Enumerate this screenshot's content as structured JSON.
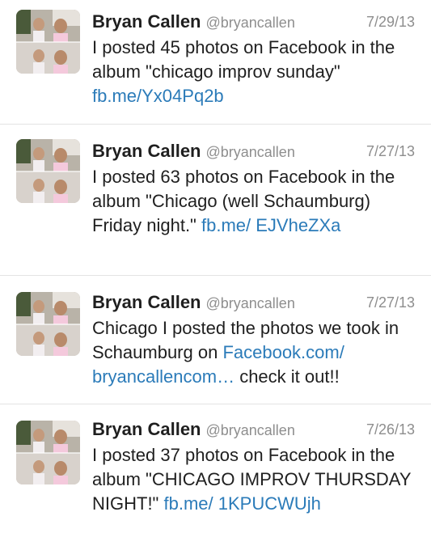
{
  "tweets": [
    {
      "name": "Bryan Callen",
      "handle": "@bryancallen",
      "date": "7/29/13",
      "text": "I posted 45 photos on Facebook in the album \"chicago improv sunday\" ",
      "link": "fb.me/Yx04Pq2b",
      "text_after": ""
    },
    {
      "name": "Bryan Callen",
      "handle": "@bryancallen",
      "date": "7/27/13",
      "text": "I posted 63 photos on Facebook in the album \"Chicago (well Schaumburg) Friday night.\" ",
      "link": "fb.me/ EJVheZXa",
      "text_after": ""
    },
    {
      "name": "Bryan Callen",
      "handle": "@bryancallen",
      "date": "7/27/13",
      "text": "Chicago I posted the photos we took in Schaumburg on ",
      "link": "Facebook.com/ bryancallencom…",
      "text_after": " check it out!!"
    },
    {
      "name": "Bryan Callen",
      "handle": "@bryancallen",
      "date": "7/26/13",
      "text": "I posted 37 photos on Facebook in the album \"CHICAGO IMPROV THURSDAY NIGHT!\" ",
      "link": "fb.me/ 1KPUCWUjh",
      "text_after": ""
    }
  ],
  "colors": {
    "link": "#2b7bb9",
    "meta": "#8e8e8e",
    "divider": "#e3e3e3"
  },
  "icons": {
    "avatar": "profile-photo-avatar"
  }
}
